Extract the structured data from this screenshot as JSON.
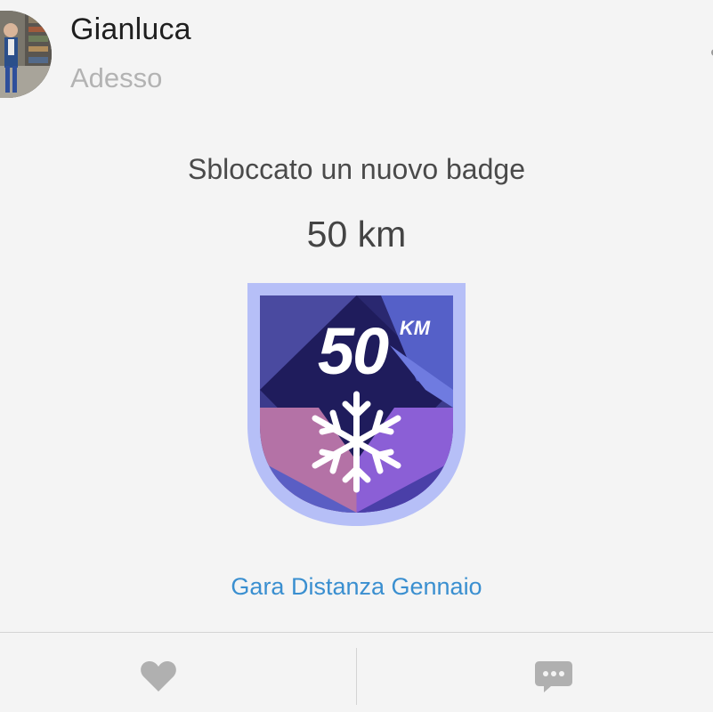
{
  "post": {
    "user_name": "Gianluca",
    "timestamp": "Adesso",
    "headline": "Sbloccato un nuovo badge",
    "badge_value": "50 km",
    "badge_number": "50",
    "badge_unit": "KM",
    "challenge_link": "Gara Distanza Gennaio"
  },
  "actions": {
    "like_icon": "heart-icon",
    "comment_icon": "speech-bubble-icon"
  },
  "colors": {
    "link": "#3a8fd0",
    "badge_border": "#b6bff7",
    "badge_dark": "#1f1c5c",
    "badge_mid": "#3c3b8c",
    "badge_light": "#6f7be0",
    "badge_pink": "#b472a6",
    "badge_purple": "#8b5fd6"
  }
}
